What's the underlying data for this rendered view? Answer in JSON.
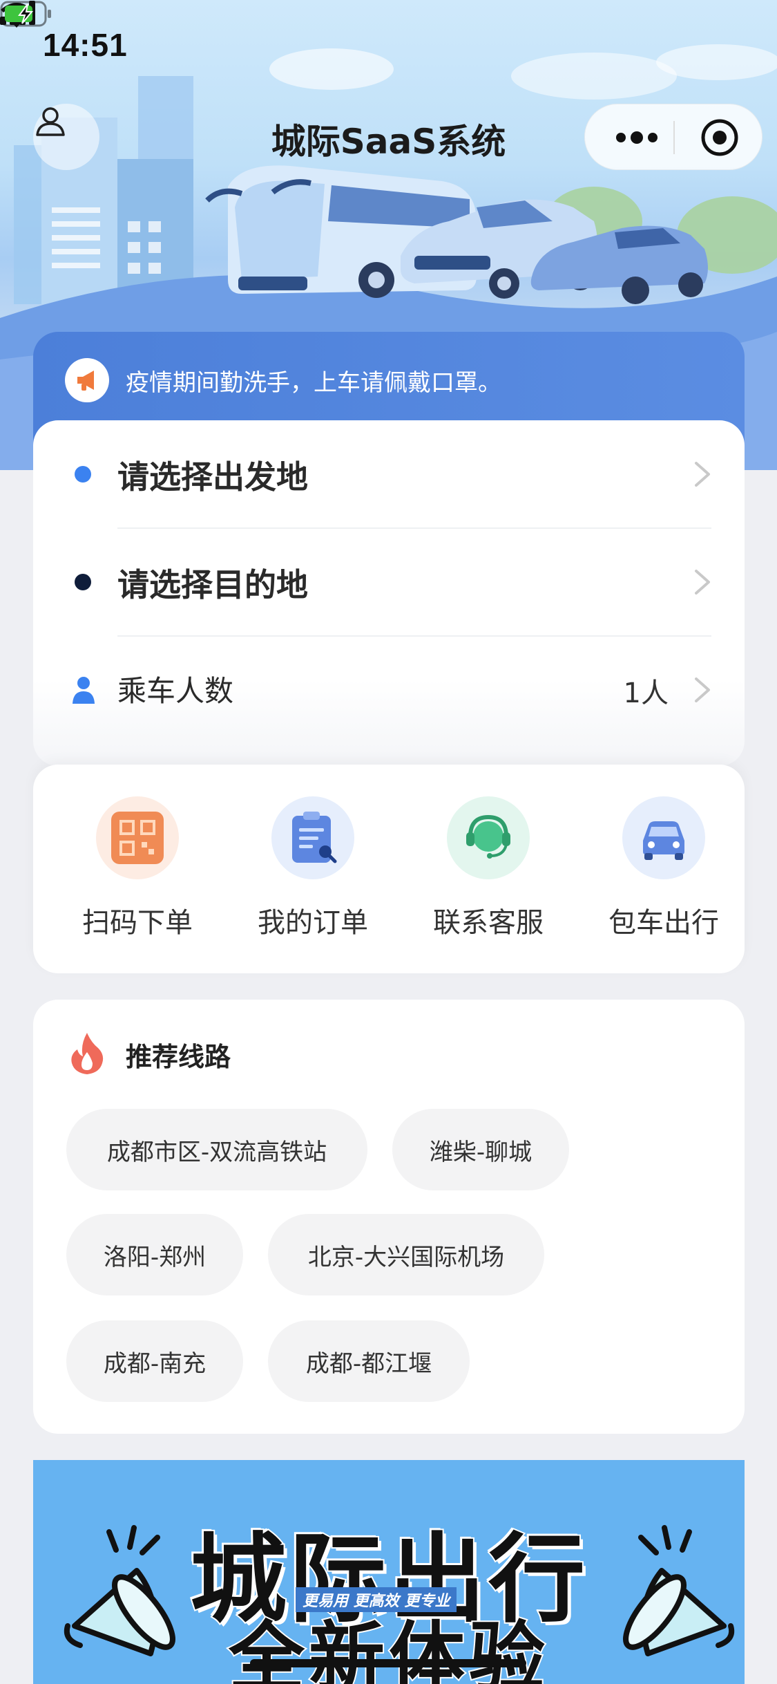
{
  "status_bar": {
    "time": "14:51"
  },
  "nav": {
    "title": "城际SaaS系统"
  },
  "notice": {
    "text": "疫情期间勤洗手，上车请佩戴口罩。"
  },
  "booking": {
    "origin_placeholder": "请选择出发地",
    "destination_placeholder": "请选择目的地",
    "passengers_label": "乘车人数",
    "passengers_value": "1人"
  },
  "actions": [
    {
      "label": "扫码下单",
      "icon": "qr-scan-icon"
    },
    {
      "label": "我的订单",
      "icon": "order-clipboard-icon"
    },
    {
      "label": "联系客服",
      "icon": "customer-service-icon"
    },
    {
      "label": "包车出行",
      "icon": "car-icon"
    }
  ],
  "routes": {
    "title": "推荐线路",
    "items": [
      "成都市区-双流高铁站",
      "潍柴-聊城",
      "洛阳-郑州",
      "北京-大兴国际机场",
      "成都-南充",
      "成都-都江堰"
    ]
  },
  "banner": {
    "headline": "城际出行",
    "tagline": "更易用 更高效 更专业",
    "subline": "全新体验"
  },
  "colors": {
    "accent_blue": "#4c7fd9",
    "origin_dot": "#3b82f0",
    "destination_dot": "#0f1d3a",
    "banner_bg": "#66b3f1"
  }
}
